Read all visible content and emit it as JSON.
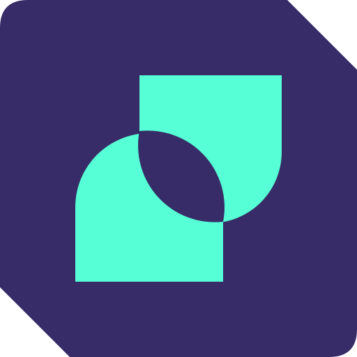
{
  "logo": {
    "background_color": "#372C67",
    "accent_color": "#56FFD6",
    "icon": "overlapping-arch-shapes-logo"
  }
}
